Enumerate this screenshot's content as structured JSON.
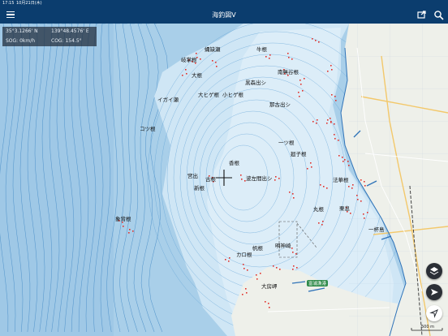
{
  "status_bar": {
    "time": "17:15",
    "date": "10月21日(木)"
  },
  "header": {
    "title": "海釣図V"
  },
  "info_panel": {
    "lat": "35°3.1266' N",
    "lon": "139°48.4576' E",
    "sog": "SOG: 0km/h",
    "cog": "COG: 154.5°"
  },
  "map_labels": [
    {
      "id": "label-kappa-sakase",
      "text": "蝿缺瀬"
    },
    {
      "id": "label-ushi-ne",
      "text": "牛根"
    },
    {
      "id": "label-kishou-ne",
      "text": "岐掌根"
    },
    {
      "id": "label-o-ne",
      "text": "大根"
    },
    {
      "id": "label-minami-muko-ne",
      "text": "南無谷根"
    },
    {
      "id": "label-kuromoridashi",
      "text": "黒森出シ"
    },
    {
      "id": "label-igai-se",
      "text": "イガイ瀬"
    },
    {
      "id": "label-o-hige-ne",
      "text": "大ヒゲ根"
    },
    {
      "id": "label-ko-hige-ne",
      "text": "小ヒゲ根"
    },
    {
      "id": "label-nakodashi",
      "text": "那古出シ"
    },
    {
      "id": "label-kotsu-ne",
      "text": "コツ根"
    },
    {
      "id": "label-ichi-no-ne",
      "text": "一ツ根"
    },
    {
      "id": "label-heiko-ne",
      "text": "廻子根"
    },
    {
      "id": "label-kou-ne",
      "text": "香根"
    },
    {
      "id": "label-miyade",
      "text": "宮出"
    },
    {
      "id": "label-ko-ne",
      "text": "古根"
    },
    {
      "id": "label-namisadashi",
      "text": "波左間出シ"
    },
    {
      "id": "label-shin-ne",
      "text": "新根"
    },
    {
      "id": "label-housu-ne",
      "text": "法華根"
    },
    {
      "id": "label-maru-ne",
      "text": "丸根"
    },
    {
      "id": "label-ura-ne",
      "text": "栗息"
    },
    {
      "id": "label-zouse-ne",
      "text": "象背根"
    },
    {
      "id": "label-ipponmatsu-ne",
      "text": "一杯島"
    },
    {
      "id": "label-meijin-saki",
      "text": "明神崎"
    },
    {
      "id": "label-kuro-ne",
      "text": "帆根"
    },
    {
      "id": "label-karo-ne",
      "text": "カロ根"
    },
    {
      "id": "label-obusa-misaki",
      "text": "大房岬"
    },
    {
      "id": "label-tateyama-bay",
      "text": "富浦漁港"
    }
  ],
  "scale_bar": {
    "label": "500 m"
  },
  "colors": {
    "sea": "#cfe6f5",
    "shallow": "#e7f2fa",
    "deep": "#a9cfe9",
    "land": "#eef0ea",
    "nav": "#0b3d6e"
  },
  "icons": [
    "menu-icon",
    "export-icon",
    "search-icon",
    "layers-icon",
    "navigate-icon",
    "locate-icon",
    "crosshair-icon"
  ]
}
